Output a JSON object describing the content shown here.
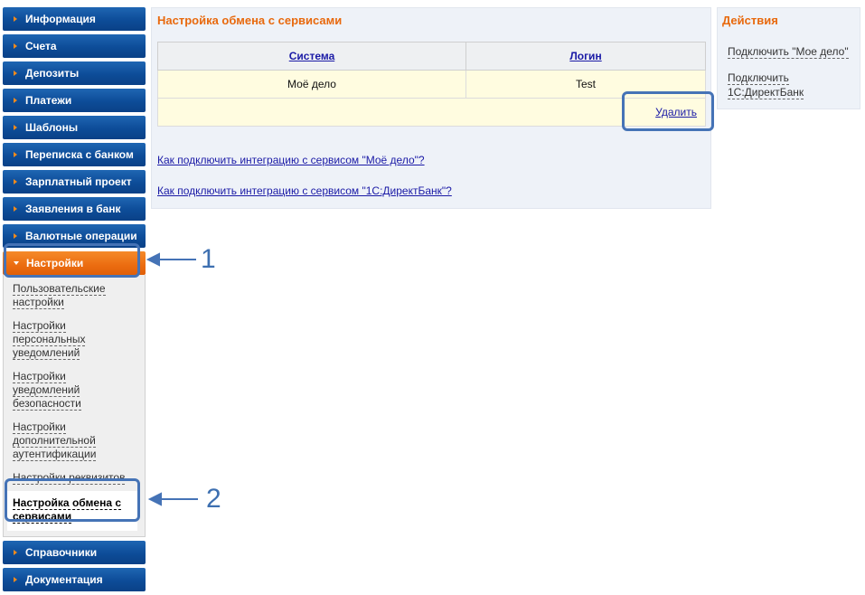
{
  "sidebar": {
    "top_items": [
      {
        "label": "Информация"
      },
      {
        "label": "Счета"
      },
      {
        "label": "Депозиты"
      },
      {
        "label": "Платежи"
      },
      {
        "label": "Шаблоны"
      },
      {
        "label": "Переписка с банком"
      },
      {
        "label": "Зарплатный проект"
      },
      {
        "label": "Заявления в банк"
      },
      {
        "label": "Валютные операции"
      }
    ],
    "active_item": {
      "label": "Настройки"
    },
    "sub_items": [
      {
        "label": "Пользовательские настройки"
      },
      {
        "label": "Настройки персональных уведомлений"
      },
      {
        "label": "Настройки уведомлений безопасности"
      },
      {
        "label": "Настройки дополнительной аутентификации"
      },
      {
        "label": "Настройки реквизитов"
      },
      {
        "label": "Настройка обмена с сервисами"
      }
    ],
    "bottom_items": [
      {
        "label": "Справочники"
      },
      {
        "label": "Документация"
      }
    ]
  },
  "main": {
    "title": "Настройка обмена с сервисами",
    "table": {
      "headers": [
        "Система",
        "Логин"
      ],
      "rows": [
        [
          "Моё дело",
          "Test"
        ]
      ],
      "delete_label": "Удалить"
    },
    "help_links": [
      "Как подключить интеграцию с сервисом \"Моё дело\"?",
      "Как подключить интеграцию с сервисом \"1С:ДиректБанк\"?"
    ]
  },
  "actions": {
    "title": "Действия",
    "links": [
      "Подключить \"Мое дело\"",
      "Подключить 1С:ДиректБанк"
    ]
  },
  "annotations": {
    "callout_1": "1",
    "callout_2": "2",
    "color": "#4573b6"
  }
}
